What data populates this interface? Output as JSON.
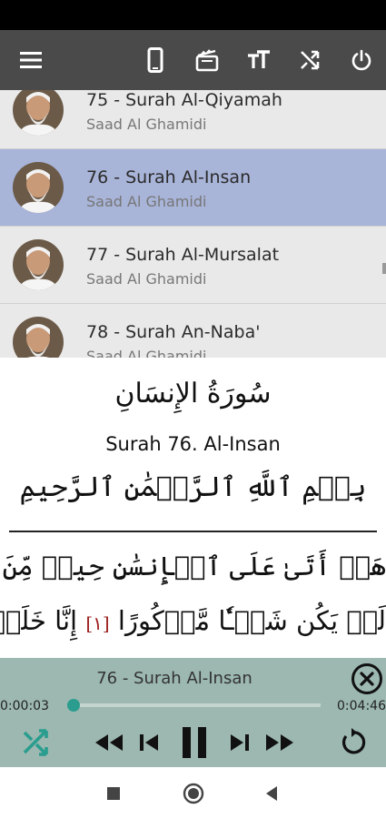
{
  "toolbar": {
    "icons": [
      "menu-icon",
      "phone-icon",
      "video-icon",
      "text-size-icon",
      "shuffle-icon",
      "power-icon"
    ]
  },
  "playlist": {
    "items": [
      {
        "title": "75 - Surah Al-Qiyamah",
        "reciter": "Saad Al Ghamidi",
        "selected": false
      },
      {
        "title": "76 - Surah Al-Insan",
        "reciter": "Saad Al Ghamidi",
        "selected": true
      },
      {
        "title": "77 - Surah Al-Mursalat",
        "reciter": "Saad Al Ghamidi",
        "selected": false
      },
      {
        "title": "78 - Surah An-Naba'",
        "reciter": "Saad Al Ghamidi",
        "selected": false
      }
    ]
  },
  "reader": {
    "surah_arabic": "سُورَةُ الإِنسَانِ",
    "surah_english": "Surah 76. Al-Insan",
    "bismillah": "بِسۡمِ ٱللَّهِ ٱلرَّحۡمَٰنِ ٱلرَّحِيمِ",
    "ayah_line_1": "هَلۡ أَتَىٰ عَلَى ٱلۡإِنسَٰنِ حِينٞ مِّنَ ٱلدَّهۡرِ",
    "ayah_line_2_a": "لَمۡ يَكُن شَيۡـٔٗا مَّذۡكُورًا",
    "ayah_number": "[١]",
    "ayah_line_2_b": "إِنَّا خَلَقۡنَا"
  },
  "player": {
    "title": "76 - Surah Al-Insan",
    "current_time": "0:00:03",
    "total_time": "0:04:46",
    "progress": 0.01
  },
  "colors": {
    "toolbar": "#4a4a4a",
    "selected_row": "#a8b4d8",
    "player_bg": "#9cb8b0",
    "accent": "#2a9d8f"
  }
}
